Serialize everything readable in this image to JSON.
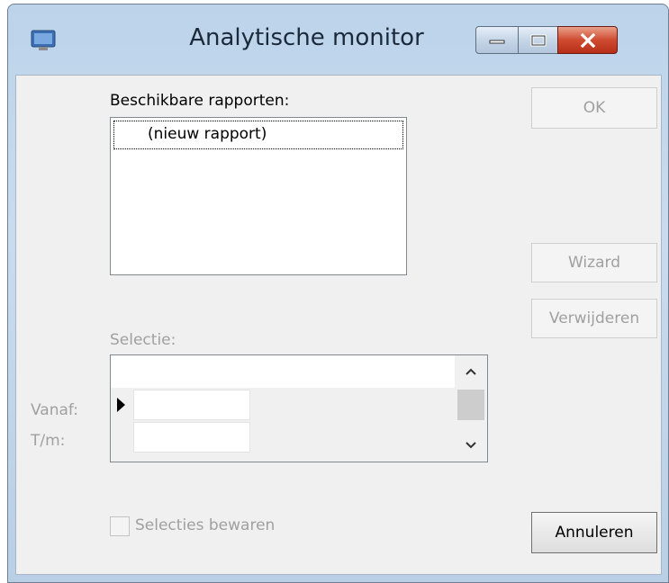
{
  "window": {
    "title": "Analytische monitor",
    "icons": {
      "app": "monitor-icon",
      "minimize": "minimize-icon",
      "maximize": "maximize-icon",
      "close": "close-icon"
    },
    "colors": {
      "close_button": "#c9442b",
      "frame": "#bcd3ea",
      "client": "#f0f0f0"
    }
  },
  "reports": {
    "label": "Beschikbare rapporten:",
    "items": [
      "(nieuw rapport)"
    ]
  },
  "buttons": {
    "ok": "OK",
    "wizard": "Wizard",
    "delete": "Verwijderen",
    "cancel": "Annuleren"
  },
  "selection": {
    "label": "Selectie:",
    "from_label": "Vanaf:",
    "to_label": "T/m:",
    "from_value": "",
    "to_value": ""
  },
  "options": {
    "save_selections_label": "Selecties bewaren",
    "save_selections_checked": false
  }
}
